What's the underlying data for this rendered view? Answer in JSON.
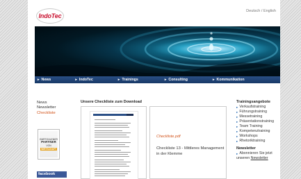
{
  "brand": {
    "logo_text": "IndoTec"
  },
  "language": {
    "de": "Deutsch",
    "separator": " / ",
    "en": "English"
  },
  "nav": {
    "items": [
      {
        "label": "News"
      },
      {
        "label": "IndoTec"
      },
      {
        "label": "Trainings"
      },
      {
        "label": "Consulting"
      },
      {
        "label": "Kommunikation"
      }
    ],
    "arrow": "▸"
  },
  "leftnav": {
    "items": [
      "News",
      "Newsletter",
      "Checkliste"
    ],
    "active_index": 2
  },
  "partner_badge": {
    "line1": "EMPFOHLENER",
    "line2": "PARTNER",
    "line3": "VON",
    "brand": "WIRTSCHAFT"
  },
  "facebook": {
    "label": "facebook"
  },
  "main": {
    "title": "Unsere Checkliste zum Download",
    "preview_link": "Checkliste.pdf",
    "preview_desc": "Checkliste 13 - Mittleres Management in der Klemme"
  },
  "sidebar": {
    "heading": "Trainingsangebote",
    "items": [
      "Verkaufstraining",
      "Führungstraining",
      "Messetraining",
      "Präsentationstraining",
      "Team Training",
      "Kompetenztraining",
      "Workshops",
      "Rhetoriktraining"
    ],
    "newsletter_heading": "Newsletter",
    "newsletter_text": "Abonnieren Sie jetzt",
    "newsletter_text2": "unseren ",
    "newsletter_link": "Newsletter"
  },
  "colors": {
    "nav": "#1f4275",
    "accent": "#d2531a",
    "facebook": "#3b5998"
  }
}
